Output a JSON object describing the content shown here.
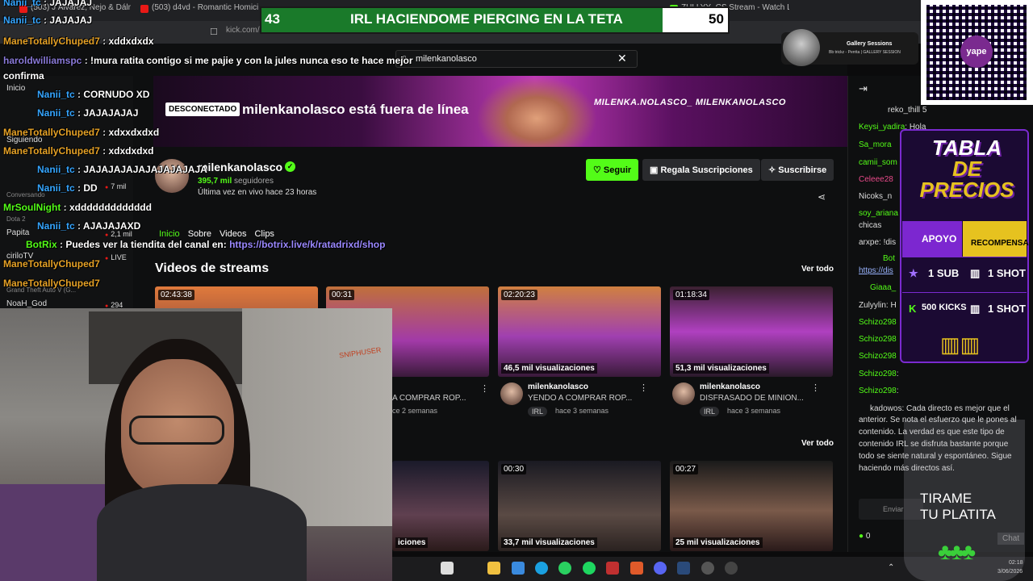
{
  "browser": {
    "tabs": [
      {
        "label": "(503) J Álvarez, Ñejo & Dálmata",
        "color": "#e91916"
      },
      {
        "label": "(503) d4vd - Romantic Homicide - Yo",
        "color": "#e91916"
      },
      {
        "label": "ZULLYY_CS Stream - Watch Live on K",
        "color": "#53fc18"
      }
    ],
    "address": "kick.com/milenkanolasco"
  },
  "overlay_title": {
    "left": "43",
    "text": "IRL HACIENDOME PIERCING EN LA TETA",
    "right": "50"
  },
  "search": {
    "value": "milenkanolasco"
  },
  "sidebar": {
    "items": [
      {
        "label": "Inicio",
        "sub": "",
        "count": ""
      },
      {
        "label": "Siguiendo",
        "sub": "",
        "count": ""
      },
      {
        "label": "",
        "sub": "Conversando",
        "count": "7 mil"
      },
      {
        "label": "Papita",
        "sub": "Dota 2",
        "count": "2,1 mil"
      },
      {
        "label": "ciriloTV",
        "sub": "",
        "count": "LIVE"
      },
      {
        "label": "",
        "sub": "Grand Theft Auto V (G...",
        "count": ""
      },
      {
        "label": "NoaH_God",
        "sub": "",
        "count": "294"
      }
    ]
  },
  "banner": {
    "badge": "DESCONECTADO",
    "offline": "milenkanolasco está fuera de línea",
    "brand": "MILENKA.NOLASCO_  MILENKANOLASCO"
  },
  "channel": {
    "name": "milenkanolasco",
    "followers": "395,7 mil",
    "followers_label": "seguidores",
    "last_live": "Última vez en vivo hace 23 horas",
    "follow": "Seguir",
    "gift": "Regala Suscripciones",
    "subscribe": "Suscribirse",
    "tabs": [
      "Inicio",
      "Sobre",
      "Videos",
      "Clips"
    ]
  },
  "section": {
    "title": "Videos de streams",
    "see_all": "Ver todo",
    "see_all_2": "Ver todo"
  },
  "videos": [
    {
      "dur": "02:43:38",
      "views": "",
      "user": "",
      "title": "",
      "tag": "",
      "when": ""
    },
    {
      "dur": "00:31",
      "views": "iones",
      "user": "",
      "title": "A COMPRAR ROP...",
      "tag": "",
      "when": "ce 2 semanas"
    },
    {
      "dur": "02:20:23",
      "views": "46,5 mil visualizaciones",
      "user": "milenkanolasco",
      "title": "YENDO A COMPRAR ROP...",
      "tag": "IRL",
      "when": "hace 3 semanas"
    },
    {
      "dur": "01:18:34",
      "views": "51,3 mil visualizaciones",
      "user": "milenkanolasco",
      "title": "DISFRASADO DE MINION...",
      "tag": "IRL",
      "when": "hace 3 semanas"
    },
    {
      "dur": "",
      "views": "iciones"
    },
    {
      "dur": "00:30",
      "views": "33,7 mil visualizaciones"
    },
    {
      "dur": "00:27",
      "views": "25 mil visualizaciones"
    }
  ],
  "left_chat": [
    {
      "user": "Nanii_tc",
      "msg": "JAJAJAJ",
      "cls": "n2"
    },
    {
      "user": "ManeTotallyChuped7",
      "msg": "xddxdxdx",
      "cls": "n"
    },
    {
      "user": "haroldwilliamspc",
      "msg": "!mura ratita contigo si me pajie y con la jules nunca eso te hace mejor",
      "cls": "n4"
    },
    {
      "user": "",
      "msg": "confirma",
      "cls": "n4"
    },
    {
      "user": "Nanii_tc",
      "msg": "CORNUDO XD",
      "cls": "n2"
    },
    {
      "user": "Nanii_tc",
      "msg": "JAJAJAJAJ",
      "cls": "n2"
    },
    {
      "user": "ManeTotallyChuped7",
      "msg": "xdxxdxdxd",
      "cls": "n"
    },
    {
      "user": "ManeTotallyChuped7",
      "msg": "xdxdxdxd",
      "cls": "n"
    },
    {
      "user": "Nanii_tc",
      "msg": "JAJAJAJAJAJAJAJAJAJA",
      "cls": "n2"
    },
    {
      "user": "Nanii_tc",
      "msg": "DD",
      "cls": "n2"
    },
    {
      "user": "MrSoulNight",
      "msg": "xddddddddddddd",
      "cls": "n3"
    },
    {
      "user": "Nanii_tc",
      "msg": "AJAJAJAXD",
      "cls": "n2"
    },
    {
      "user": "BotRix",
      "msg": "Puedes ver la tiendita del canal en:",
      "url": "https://botrix.live/k/ratadrixd/shop",
      "cls": "n3"
    },
    {
      "user": "ManeTotallyChuped7",
      "msg": "",
      "cls": "n"
    },
    {
      "user": "ManeTotallyChuped7",
      "msg": "",
      "cls": "n"
    }
  ],
  "right_chat": [
    {
      "user": "reko_thill",
      "msg": "5"
    },
    {
      "user": "Keysi_yadira",
      "msg": "Hola"
    },
    {
      "user": "Sa_mora",
      "msg": ""
    },
    {
      "user": "camii_som",
      "msg": ""
    },
    {
      "user": "Celeee28",
      "msg": ""
    },
    {
      "user": "Nicoks_n",
      "msg": ""
    },
    {
      "user": "soy_ariana",
      "msg": ""
    },
    {
      "user": "",
      "msg": "chicas"
    },
    {
      "user": "arxpe",
      "msg": "!dis"
    },
    {
      "user": "Bot",
      "msg": ""
    },
    {
      "user": "",
      "msg": "https://dis"
    },
    {
      "user": "Giaaa_",
      "msg": ""
    },
    {
      "user": "Zulyylin",
      "msg": "H"
    },
    {
      "user": "Schizo298",
      "msg": ""
    },
    {
      "user": "Schizo298",
      "msg": ""
    },
    {
      "user": "Schizo298",
      "msg": ""
    },
    {
      "user": "Schizo298",
      "msg": ""
    },
    {
      "user": "Schizo298",
      "msg": ""
    },
    {
      "user": "kadowos",
      "msg": "Cada directo es mejor que el"
    },
    {
      "user": "",
      "msg": "anterior. Se nota el esfuerzo que le pones al"
    },
    {
      "user": "",
      "msg": "contenido. La verdad es que este tipo de"
    },
    {
      "user": "",
      "msg": "contenido IRL se disfruta bastante porque"
    },
    {
      "user": "",
      "msg": "todo se siente natural y espontáneo. Sigue"
    },
    {
      "user": "",
      "msg": "haciendo más directos así."
    }
  ],
  "chat_input": {
    "placeholder": "Enviar"
  },
  "chat_footer": {
    "count": "0",
    "send": "Chat"
  },
  "gallery": {
    "title": "Gallery Sessions",
    "sub": "Bb trickz - Perrita | GALLERY SESSION"
  },
  "qr": {
    "label": "yape"
  },
  "price_table": {
    "title_1": "TABLA",
    "title_2": "DE PRECIOS",
    "col1": "APOYO",
    "col2": "RECOMPENSA",
    "rows": [
      {
        "apoyo": "1 SUB",
        "recompensa": "1 SHOT"
      },
      {
        "apoyo": "500 KICKS",
        "recompensa": "1 SHOT"
      }
    ]
  },
  "tip_jar": {
    "line1": "TIRAME",
    "line2": "TU PLATITA"
  },
  "cam_text": "SNIPHUSER",
  "clock": {
    "time": "02:18",
    "date": "3/06/2026"
  },
  "colors": {
    "kick_green": "#53fc18",
    "purple": "#7c27d0",
    "gold": "#e6c21f"
  }
}
